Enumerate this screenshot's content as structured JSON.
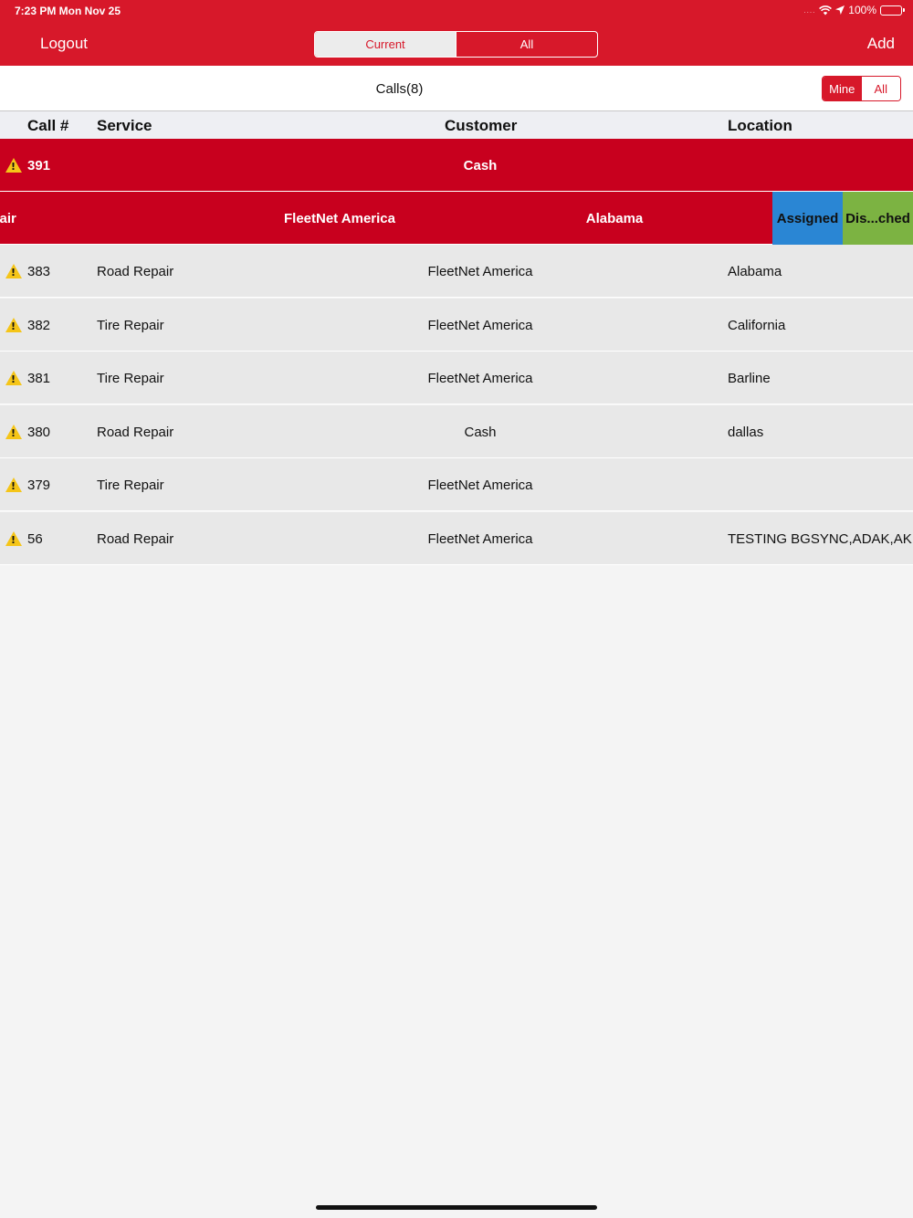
{
  "status_bar": {
    "time": "7:23 PM  Mon Nov 25",
    "signal": "....",
    "battery": "100%"
  },
  "nav": {
    "logout_label": "Logout",
    "add_label": "Add",
    "segments": [
      "Current",
      "All"
    ],
    "selected_segment": "Current"
  },
  "subheader": {
    "title": "Calls(8)",
    "filter_segments": [
      "Mine",
      "All"
    ],
    "selected_filter": "Mine"
  },
  "columns": {
    "call": "Call #",
    "service": "Service",
    "customer": "Customer",
    "location": "Location"
  },
  "selected_row": {
    "call": "391",
    "service": "",
    "customer": "Cash",
    "location": ""
  },
  "swiped_row": {
    "service": "epair",
    "customer": "FleetNet America",
    "location": "Alabama",
    "actions": [
      "Assigned",
      "Dis...ched"
    ]
  },
  "rows": [
    {
      "call": "383",
      "service": "Road Repair",
      "customer": "FleetNet America",
      "location": "Alabama"
    },
    {
      "call": "382",
      "service": "Tire Repair",
      "customer": "FleetNet America",
      "location": "California"
    },
    {
      "call": "381",
      "service": "Tire Repair",
      "customer": "FleetNet America",
      "location": "Barline"
    },
    {
      "call": "380",
      "service": "Road Repair",
      "customer": "Cash",
      "location": "dallas"
    },
    {
      "call": "379",
      "service": "Tire Repair",
      "customer": "FleetNet America",
      "location": ""
    },
    {
      "call": "56",
      "service": "Road Repair",
      "customer": "FleetNet America",
      "location": "TESTING BGSYNC,ADAK,AK"
    }
  ],
  "colors": {
    "brand_red": "#d7182a",
    "selected_row": "#c8001e",
    "assigned_action": "#2a86d4",
    "dispatched_action": "#7cb342",
    "warning": "#f5c518"
  },
  "icons": {
    "row_status": "warning-icon",
    "wifi": "wifi-icon",
    "location": "location-arrow-icon",
    "battery": "battery-icon"
  }
}
